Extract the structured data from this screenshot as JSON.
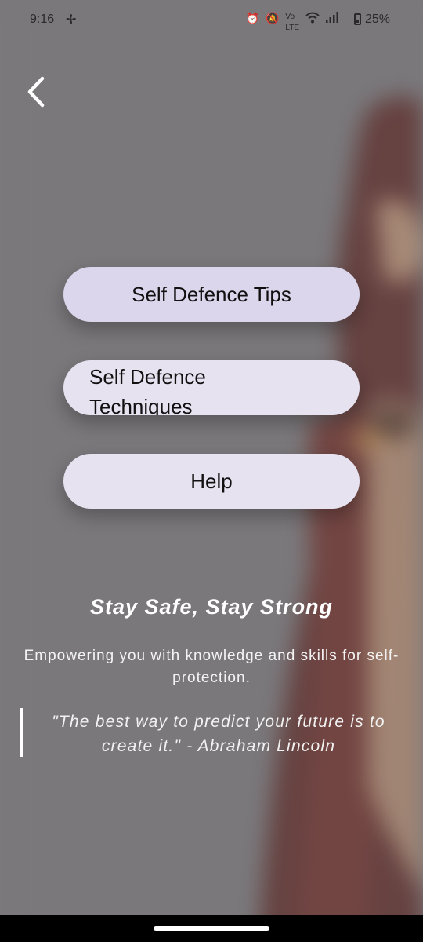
{
  "status_bar": {
    "time": "9:16",
    "fan_icon": "fan-icon",
    "icons": [
      "alarm-icon",
      "bell-off-icon",
      "volte-icon",
      "wifi-icon",
      "signal-icon",
      "battery-icon"
    ],
    "battery": "25%"
  },
  "nav": {
    "back_icon": "chevron-left-icon"
  },
  "menu": {
    "tips_label": "Self Defence Tips",
    "techniques_label": "Self Defence Techniques",
    "help_label": "Help"
  },
  "content": {
    "tagline": "Stay Safe, Stay Strong",
    "subtitle": "Empowering you with knowledge and skills for self-protection.",
    "quote": "\"The best way to predict your future is to create it.\" - Abraham Lincoln"
  },
  "colors": {
    "background": "#7a797b",
    "button": "#e6e2f0",
    "button_primary": "#dcd6ec",
    "text_light": "#ffffff"
  }
}
